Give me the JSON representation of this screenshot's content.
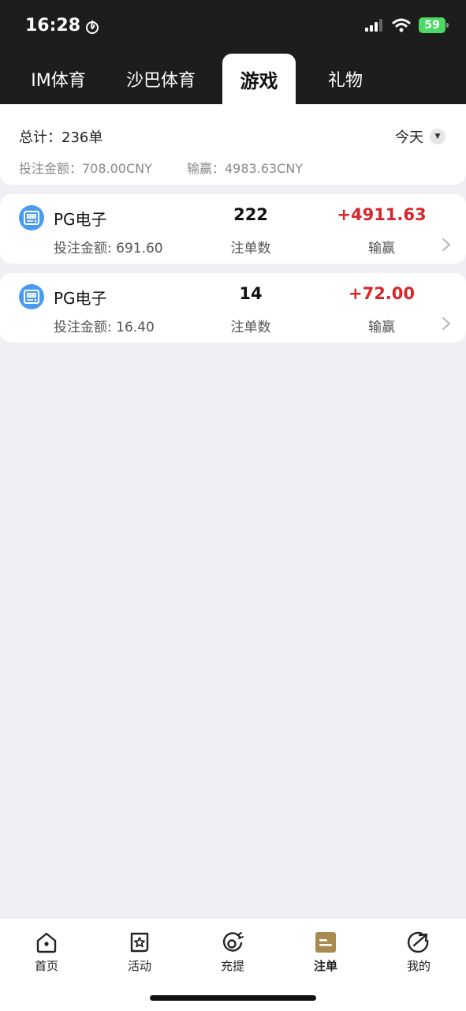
{
  "status_bar": {
    "time": "16:28",
    "battery": "59"
  },
  "tabs": [
    {
      "label": "IM体育",
      "active": false
    },
    {
      "label": "沙巴体育",
      "active": false
    },
    {
      "label": "游戏",
      "active": true
    },
    {
      "label": "礼物",
      "active": false
    }
  ],
  "summary": {
    "total": "总计：236单",
    "bet_amount": "投注金额：708.00CNY",
    "win_loss": "输赢：4983.63CNY",
    "date_filter": "今天"
  },
  "records": [
    {
      "name": "PG电子",
      "bet": "投注金额: 691.60",
      "count": "222",
      "count_label": "注单数",
      "amount": "+4911.63",
      "amount_label": "输赢"
    },
    {
      "name": "PG电子",
      "bet": "投注金额: 16.40",
      "count": "14",
      "count_label": "注单数",
      "amount": "+72.00",
      "amount_label": "输赢"
    }
  ],
  "bottom_nav": [
    {
      "label": "首页",
      "icon": "home-icon",
      "active": false
    },
    {
      "label": "活动",
      "icon": "star-icon",
      "active": false
    },
    {
      "label": "充提",
      "icon": "deposit-icon",
      "active": false
    },
    {
      "label": "注单",
      "icon": "bet-slip-icon",
      "active": true
    },
    {
      "label": "我的",
      "icon": "profile-icon",
      "active": false
    }
  ],
  "colors": {
    "header_bg": "#1d1d1d",
    "page_bg": "#efeff4",
    "win_red": "#d8262b",
    "active_nav": "#a88c4f",
    "battery_green": "#4cd964"
  }
}
